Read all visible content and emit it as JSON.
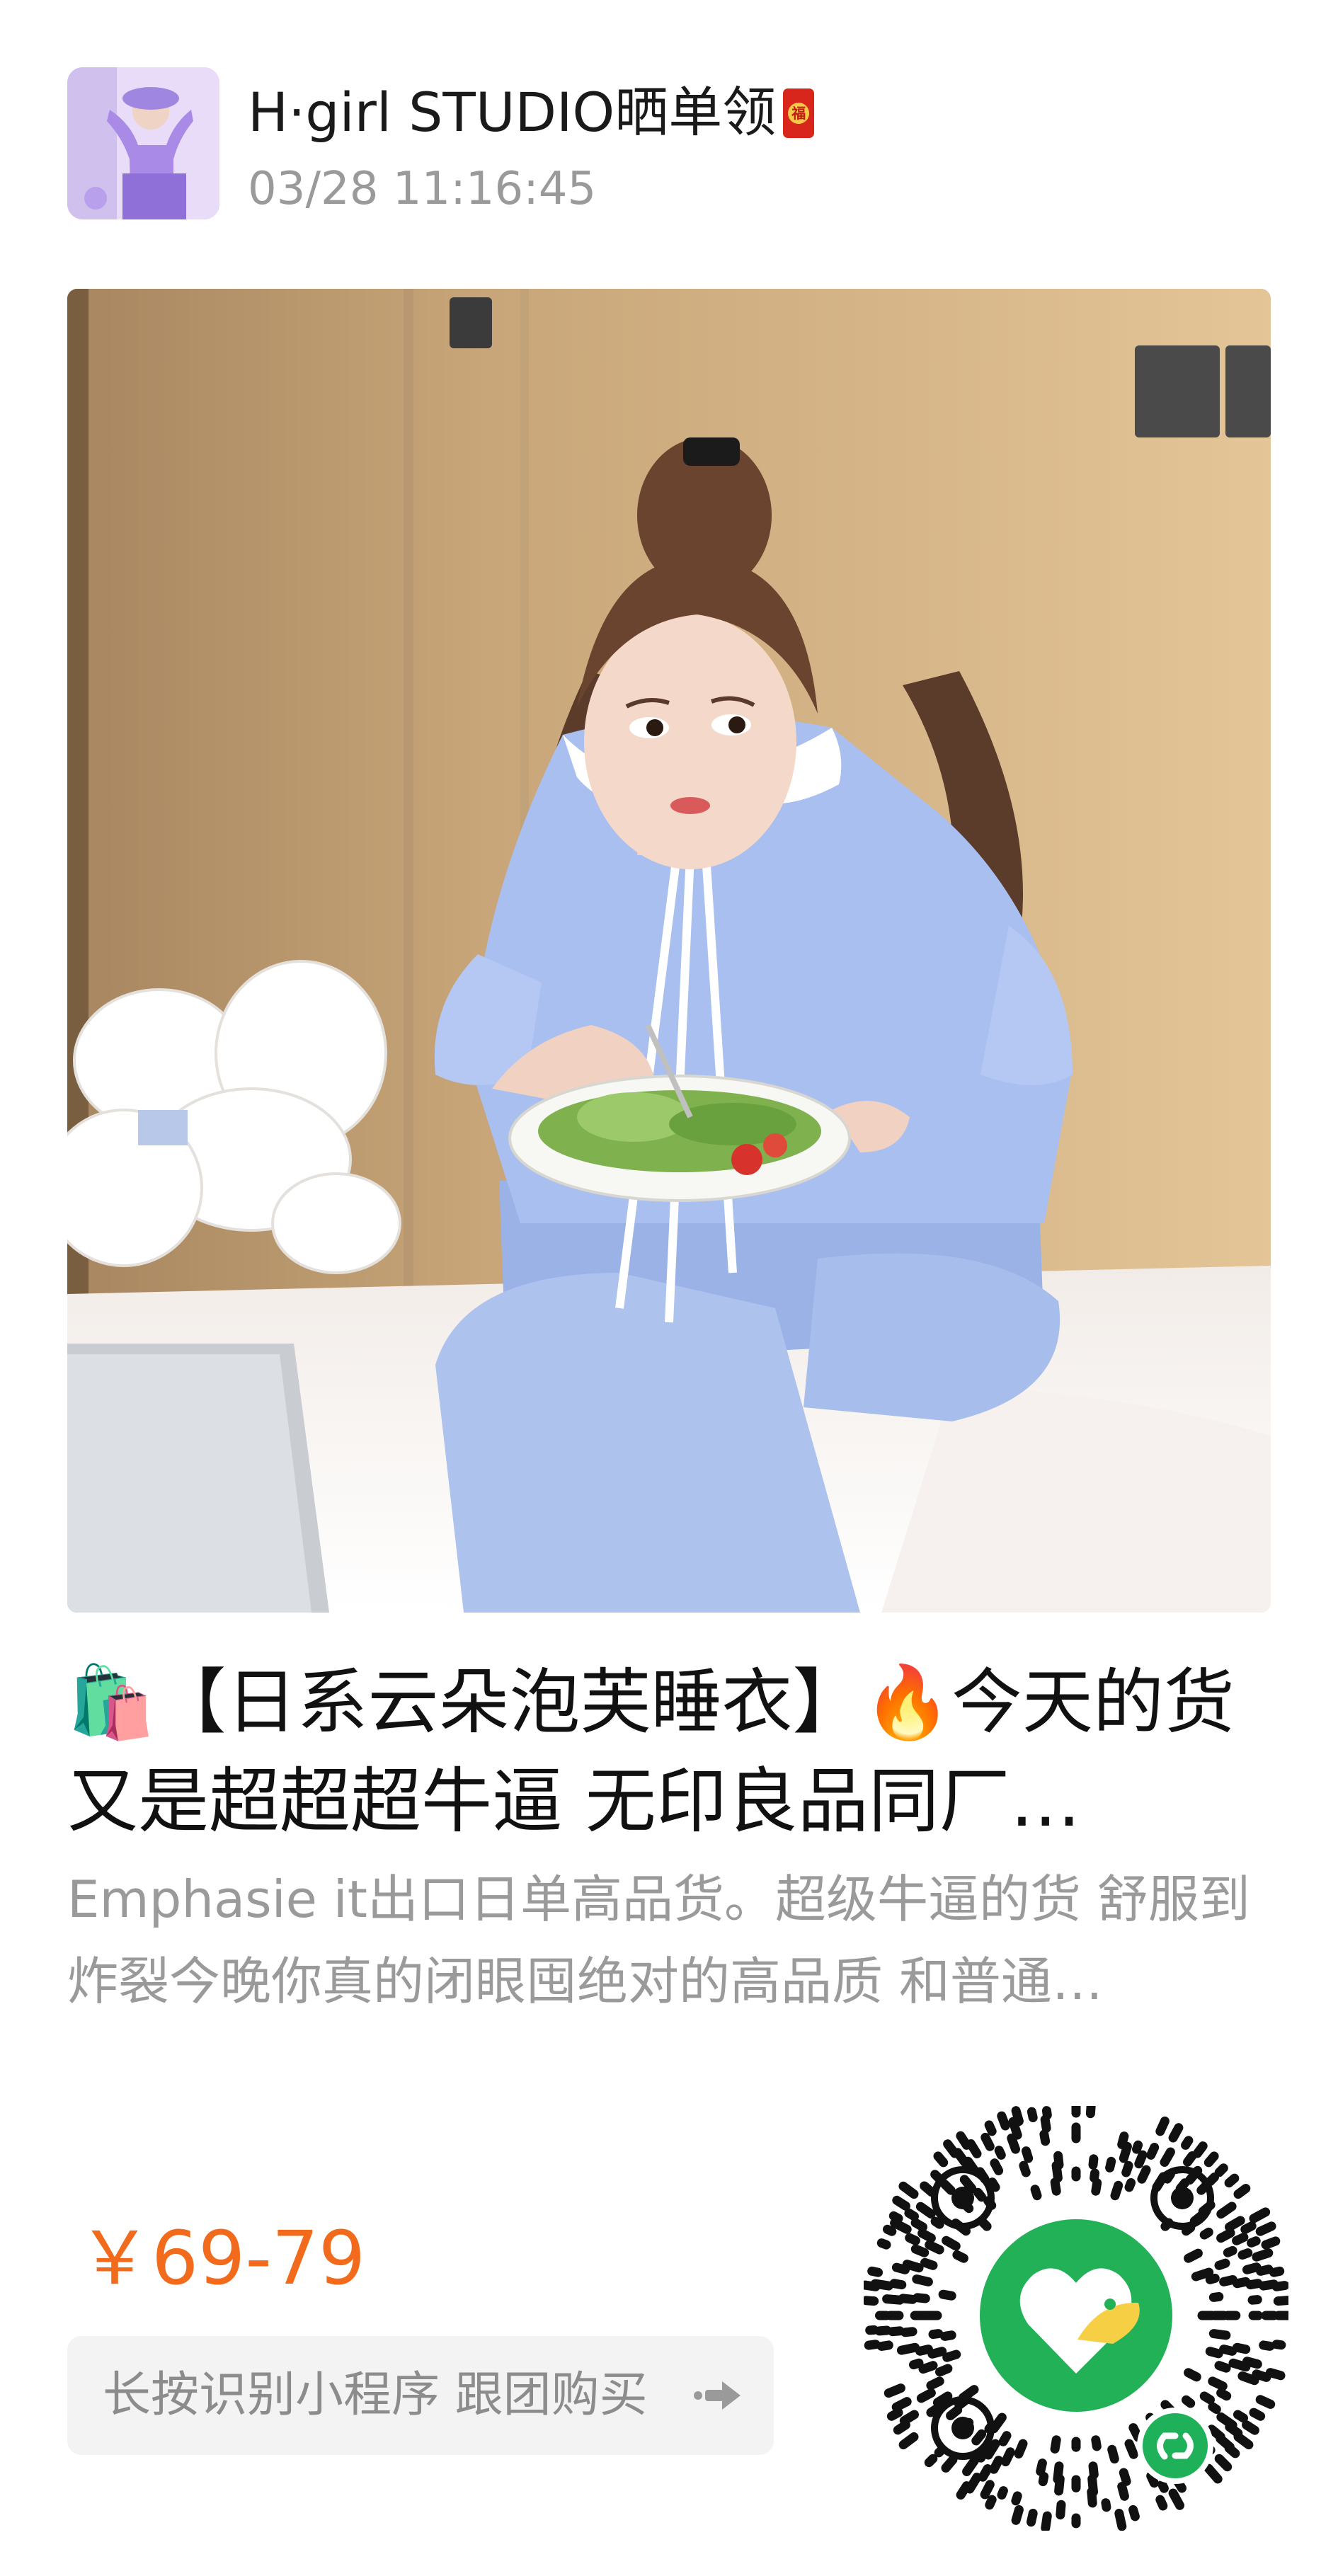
{
  "header": {
    "store_name": "H·girl STUDIO晒单领",
    "timestamp": "03/28 11:16:45",
    "badge_icon": "red-envelope-icon",
    "badge_glyph": "福"
  },
  "product": {
    "title": "🛍️【日系云朵泡芙睡衣】🔥今天的货又是超超超牛逼 无印良品同厂…",
    "description": "Emphasie it出口日单高品货。超级牛逼的货 舒服到炸裂今晚你真的闭眼囤绝对的高品质 和普通…",
    "price": "￥69-79"
  },
  "cta": {
    "label": "长按识别小程序 跟团购买",
    "icon": "arrow-right-icon"
  },
  "colors": {
    "price": "#f26a1b",
    "qr_center": "#22b157",
    "mini_program_badge": "#1fb15a"
  }
}
